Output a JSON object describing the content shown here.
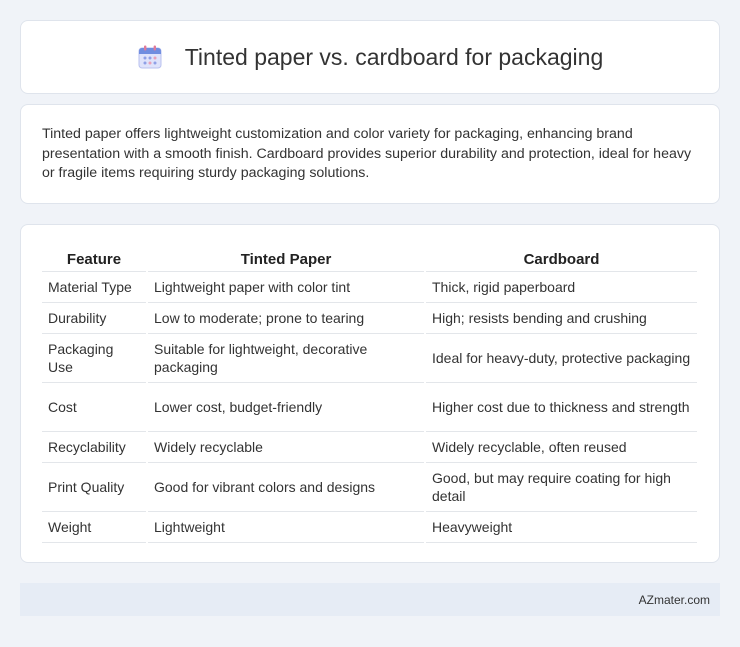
{
  "header": {
    "title": "Tinted paper vs. cardboard for packaging",
    "icon": "calendar-icon"
  },
  "intro": {
    "text": "Tinted paper offers lightweight customization and color variety for packaging, enhancing brand presentation with a smooth finish. Cardboard provides superior durability and protection, ideal for heavy or fragile items requiring sturdy packaging solutions."
  },
  "table": {
    "headers": [
      "Feature",
      "Tinted Paper",
      "Cardboard"
    ],
    "rows": [
      [
        "Material Type",
        "Lightweight paper with color tint",
        "Thick, rigid paperboard"
      ],
      [
        "Durability",
        "Low to moderate; prone to tearing",
        "High; resists bending and crushing"
      ],
      [
        "Packaging Use",
        "Suitable for lightweight, decorative packaging",
        "Ideal for heavy-duty, protective packaging"
      ],
      [
        "Cost",
        "Lower cost, budget-friendly",
        "Higher cost due to thickness and strength"
      ],
      [
        "Recyclability",
        "Widely recyclable",
        "Widely recyclable, often reused"
      ],
      [
        "Print Quality",
        "Good for vibrant colors and designs",
        "Good, but may require coating for high detail"
      ],
      [
        "Weight",
        "Lightweight",
        "Heavyweight"
      ]
    ]
  },
  "footer": {
    "brand": "AZmater.com"
  },
  "colors": {
    "page_background": "#f0f3f8",
    "card_background": "#ffffff",
    "footer_background": "#e6ecf5"
  }
}
